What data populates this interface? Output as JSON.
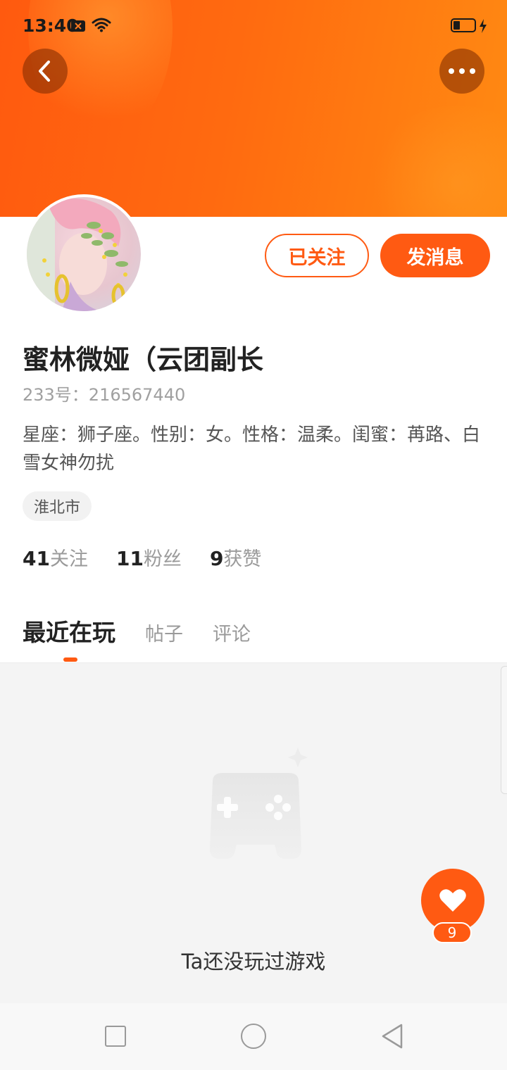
{
  "status_bar": {
    "time": "13:40"
  },
  "profile": {
    "name": "蜜林微娅（云团副长",
    "id_text": "233号：216567440",
    "bio": "星座：狮子座。性别：女。性格：温柔。闺蜜：苒路、白雪女神勿扰",
    "location": "淮北市"
  },
  "actions": {
    "followed_label": "已关注",
    "message_label": "发消息"
  },
  "stats": [
    {
      "num": "41",
      "label": "关注"
    },
    {
      "num": "11",
      "label": "粉丝"
    },
    {
      "num": "9",
      "label": "获赞"
    }
  ],
  "tabs": [
    {
      "label": "最近在玩",
      "active": true
    },
    {
      "label": "帖子"
    },
    {
      "label": "评论"
    }
  ],
  "empty_state": {
    "text": "Ta还没玩过游戏"
  },
  "like": {
    "count": "9"
  },
  "colors": {
    "accent": "#ff5a12",
    "banner_start": "#ff5a0f",
    "banner_end": "#ff8a12"
  }
}
